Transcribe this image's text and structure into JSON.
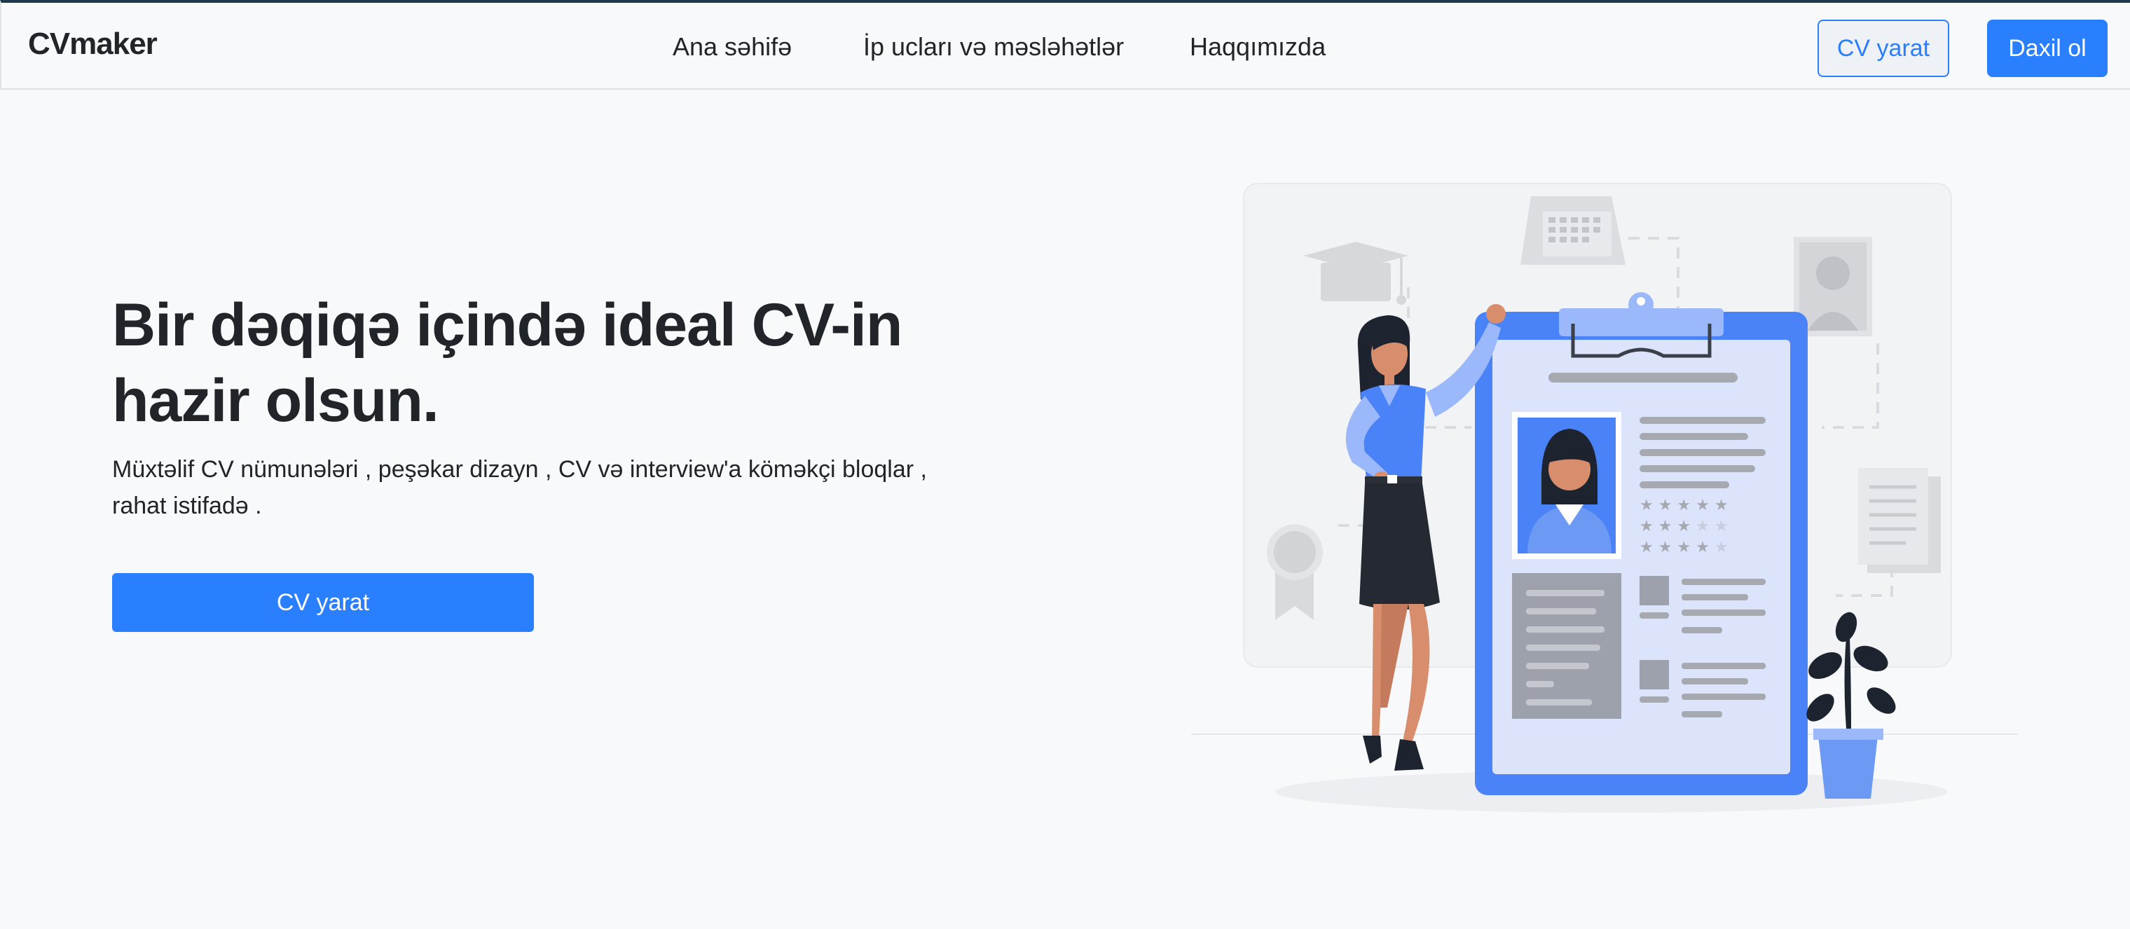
{
  "header": {
    "brand": "CVmaker",
    "nav": [
      "Ana səhifə",
      "İp ucları və məsləhətlər",
      "Haqqımızda"
    ],
    "create_cv_label": "CV yarat",
    "login_label": "Daxil ol"
  },
  "hero": {
    "title_line1": "Bir dəqiqə içində ideal CV-in",
    "title_line2": "hazir olsun.",
    "subtitle_line1": "Müxtəlif CV nümunələri , peşəkar dizayn , CV və interview'a köməkçi bloqlar ,",
    "subtitle_line2": "rahat istifadə .",
    "cta_label": "CV yarat"
  },
  "colors": {
    "primary": "#2a7fff",
    "background": "#f8f9fa",
    "text": "#212529"
  },
  "illustration": {
    "icon": "woman-with-cv-clipboard-illustration"
  }
}
